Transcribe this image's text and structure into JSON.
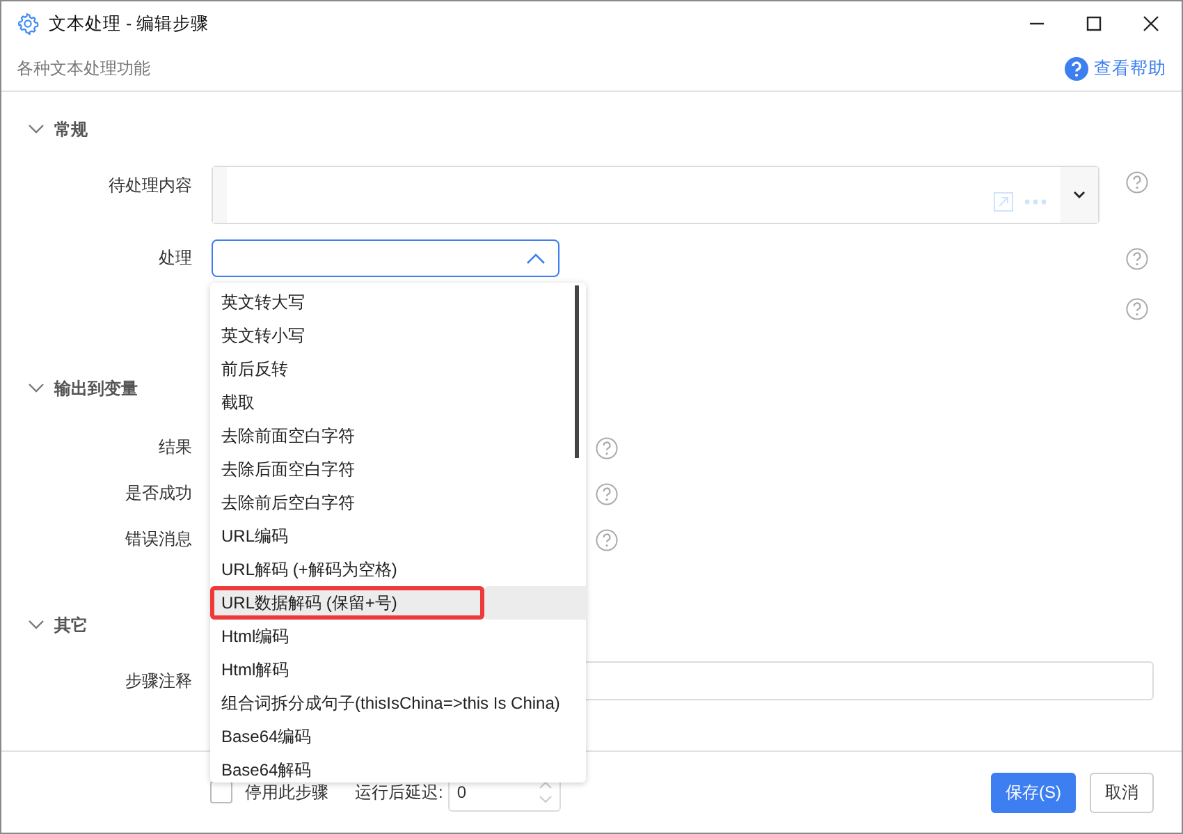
{
  "window": {
    "title": "文本处理 - 编辑步骤",
    "subtitle": "各种文本处理功能",
    "help_link": "查看帮助"
  },
  "sections": [
    {
      "title": "常规",
      "expanded": true,
      "rows": [
        {
          "kind": "content",
          "label": "待处理内容"
        },
        {
          "kind": "select",
          "label": "处理",
          "open": true
        },
        {
          "kind": "covered"
        }
      ]
    },
    {
      "title": "输出到变量",
      "expanded": true,
      "rows": [
        {
          "kind": "output",
          "label": "结果"
        },
        {
          "kind": "output",
          "label": "是否成功"
        },
        {
          "kind": "output",
          "label": "错误消息"
        }
      ]
    },
    {
      "title": "其它",
      "expanded": true,
      "rows": [
        {
          "kind": "text",
          "label": "步骤注释"
        }
      ]
    }
  ],
  "dropdown": {
    "options": [
      {
        "label": "英文转大写",
        "selected": false
      },
      {
        "label": "英文转小写",
        "selected": false
      },
      {
        "label": "前后反转",
        "selected": false
      },
      {
        "label": "截取",
        "selected": false
      },
      {
        "label": "去除前面空白字符",
        "selected": false
      },
      {
        "label": "去除后面空白字符",
        "selected": false
      },
      {
        "label": "去除前后空白字符",
        "selected": false
      },
      {
        "label": "URL编码",
        "selected": false
      },
      {
        "label": "URL解码 (+解码为空格)",
        "selected": false
      },
      {
        "label": "URL数据解码 (保留+号)",
        "selected": true
      },
      {
        "label": "Html编码",
        "selected": false
      },
      {
        "label": "Html解码",
        "selected": false
      },
      {
        "label": "组合词拆分成句子(thisIsChina=>this Is China)",
        "selected": false
      },
      {
        "label": "Base64编码",
        "selected": false
      },
      {
        "label": "Base64解码",
        "selected": false
      }
    ]
  },
  "footer": {
    "disable_label": "停用此步骤",
    "disable_checked": false,
    "delay_label": "运行后延迟:",
    "delay_value": "0",
    "save": "保存(S)",
    "cancel": "取消"
  }
}
